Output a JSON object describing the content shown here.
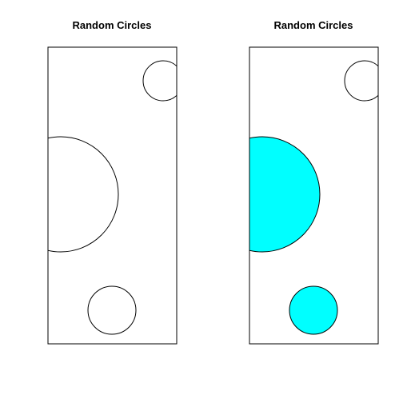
{
  "colors": {
    "background": "#ffffff",
    "stroke": "#000000",
    "fill_highlight": "#00ffff"
  },
  "panels": [
    {
      "title": "Random Circles",
      "circles": [
        {
          "id": "top-right",
          "filled": false
        },
        {
          "id": "middle-left",
          "filled": false
        },
        {
          "id": "bottom",
          "filled": false
        }
      ]
    },
    {
      "title": "Random Circles",
      "circles": [
        {
          "id": "top-right",
          "filled": false
        },
        {
          "id": "middle-left",
          "filled": true
        },
        {
          "id": "bottom",
          "filled": true
        }
      ]
    }
  ]
}
